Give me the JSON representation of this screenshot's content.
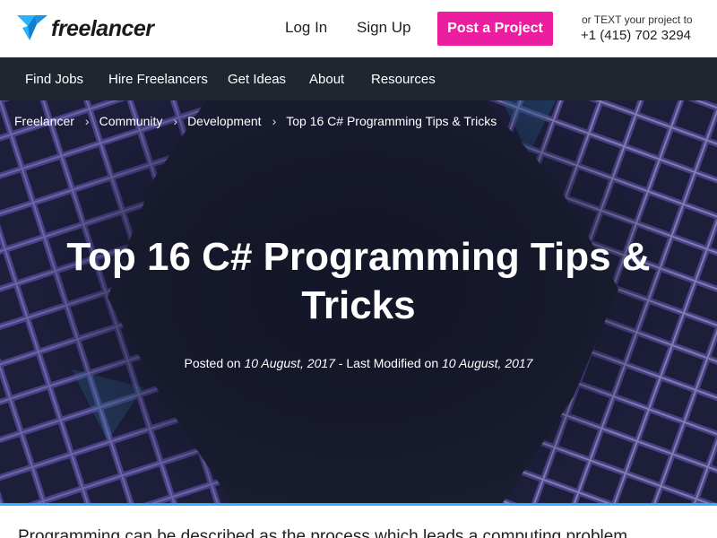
{
  "header": {
    "logo_text": "freelancer",
    "login_label": "Log In",
    "signup_label": "Sign Up",
    "post_project_label": "Post a Project",
    "text_prompt": "or TEXT your project to",
    "phone": "+1 (415) 702 3294",
    "brand_color": "#29b2fe",
    "accent_color": "#ec1ea0"
  },
  "mainnav": {
    "items": [
      {
        "label": "Find Jobs"
      },
      {
        "label": "Hire Freelancers"
      },
      {
        "label": "Get Ideas"
      },
      {
        "label": "About"
      },
      {
        "label": "Resources"
      }
    ]
  },
  "breadcrumb": {
    "items": [
      "Freelancer",
      "Community",
      "Development",
      "Top 16 C# Programming Tips & Tricks"
    ],
    "separator": "›"
  },
  "article": {
    "title": "Top 16 C# Programming Tips & Tricks",
    "posted_prefix": "Posted on",
    "posted_date": "10 August, 2017",
    "modified_prefix": "- Last Modified on",
    "modified_date": "10 August, 2017",
    "intro_fragment": "Programming can be described as the process which leads a computing problem"
  }
}
